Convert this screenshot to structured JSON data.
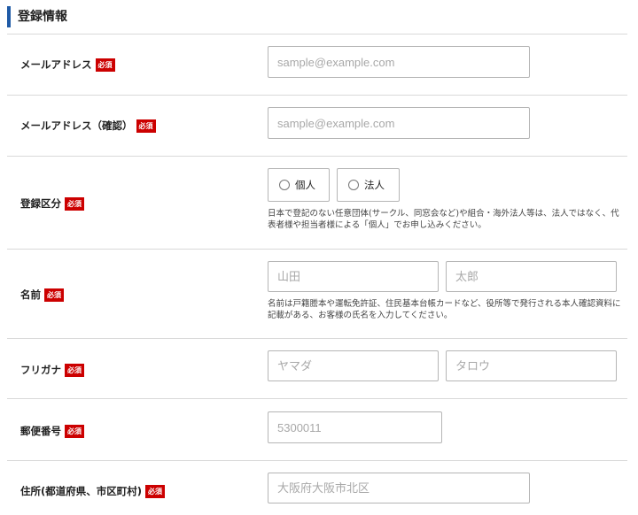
{
  "section_title": "登録情報",
  "required_badge": "必須",
  "email": {
    "label": "メールアドレス",
    "placeholder": "sample@example.com"
  },
  "email_confirm": {
    "label": "メールアドレス（確認）",
    "placeholder": "sample@example.com"
  },
  "registration_type": {
    "label": "登録区分",
    "options": [
      "個人",
      "法人"
    ],
    "help": "日本で登記のない任意団体(サークル、同窓会など)や組合・海外法人等は、法人ではなく、代表者様や担当者様による「個人」でお申し込みください。"
  },
  "name": {
    "label": "名前",
    "last_placeholder": "山田",
    "first_placeholder": "太郎",
    "help": "名前は戸籍謄本や運転免許証、住民基本台帳カードなど、役所等で発行される本人確認資料に記載がある、お客様の氏名を入力してください。"
  },
  "furigana": {
    "label": "フリガナ",
    "last_placeholder": "ヤマダ",
    "first_placeholder": "タロウ"
  },
  "postal_code": {
    "label": "郵便番号",
    "placeholder": "5300011"
  },
  "address": {
    "label": "住所(都道府県、市区町村)",
    "placeholder": "大阪府大阪市北区"
  }
}
